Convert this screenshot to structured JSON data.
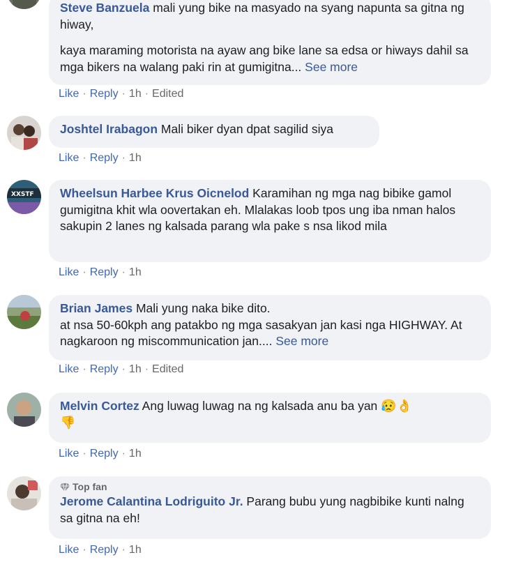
{
  "labels": {
    "like": "Like",
    "reply": "Reply",
    "see_more": "See more",
    "dot": "·",
    "edited": "Edited"
  },
  "comments": [
    {
      "author": "Steve Banzuela",
      "text1": " mali yung bike na masyado na syang napunta sa gitna ng hiway,",
      "text2": "kaya maraming motorista na ayaw ang bike lane sa edsa or hiways dahil sa mga bikers na walang paki rin at gumigitna...",
      "time": "1h"
    },
    {
      "author": "Joshtel Irabagon",
      "text1": " Mali biker dyan dpat sagilid siya",
      "time": "1h"
    },
    {
      "author": "Wheelsun Harbee Krus Oicnelod",
      "text1": " Karamihan ng mga nag bibike gamol gumigitna khit wla oovertakan eh. Mlalakas loob tpos ung iba nman halos sakupin 2 lanes ng kalsada parang wla pake s nsa likod mila",
      "time": "1h"
    },
    {
      "author": "Brian James",
      "text1": " Mali yung naka bike dito.",
      "text2": "at nsa 50-60kph ang patakbo ng mga sasakyan jan kasi nga HIGHWAY. At nagkaroon ng miscommunication jan....",
      "time": "1h"
    },
    {
      "author": "Melvin Cortez",
      "text1": " Ang luwag luwag na ng kalsada anu ba yan",
      "emojis": [
        "😥",
        "👌",
        "👎"
      ],
      "time": "1h"
    },
    {
      "author": "Jerome Calantina Lodriguito Jr.",
      "badge": "Top fan",
      "text1": " Parang bubu yung nagbibike kunti nalng sa gitna na eh!",
      "time": "1h"
    }
  ]
}
